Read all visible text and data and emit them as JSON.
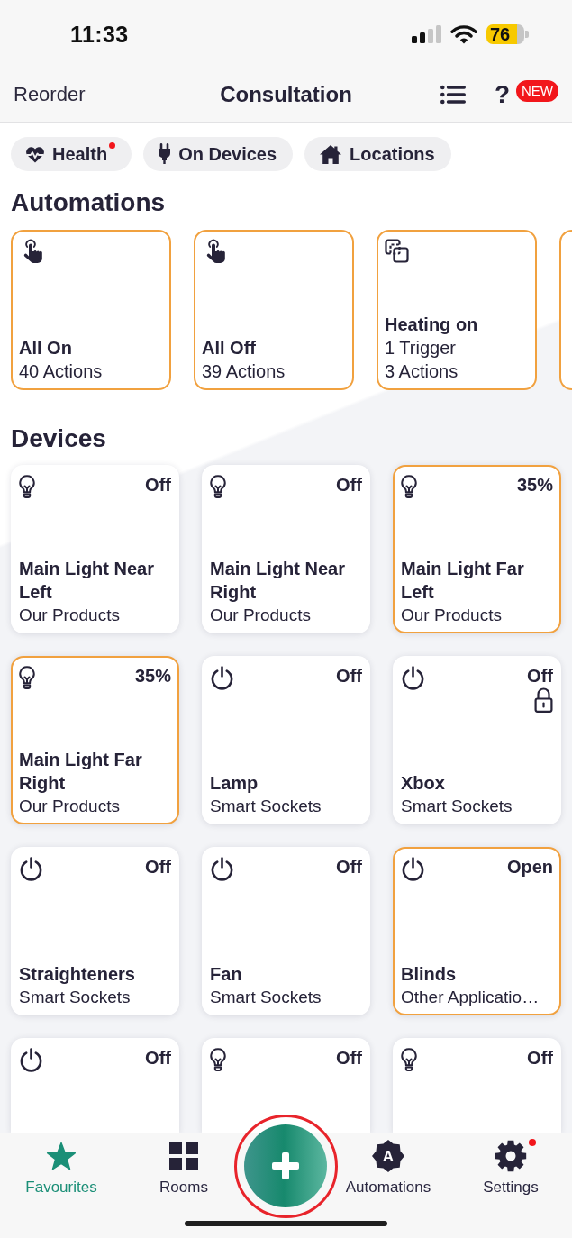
{
  "status_bar": {
    "time": "11:33",
    "battery": "76"
  },
  "nav_bar": {
    "reorder": "Reorder",
    "title": "Consultation",
    "help": "?",
    "help_badge": "NEW"
  },
  "filters": [
    {
      "kind": "health",
      "label": "Health",
      "notification": true
    },
    {
      "kind": "devices",
      "label": "On Devices",
      "notification": false
    },
    {
      "kind": "locations",
      "label": "Locations",
      "notification": false
    }
  ],
  "automations": {
    "heading": "Automations",
    "cards": [
      {
        "kind": "manual",
        "title": "All On",
        "details": [
          "40 Actions"
        ]
      },
      {
        "kind": "manual",
        "title": "All Off",
        "details": [
          "39 Actions"
        ]
      },
      {
        "kind": "triggered",
        "title": "Heating on",
        "details": [
          "1 Trigger",
          "3 Actions"
        ]
      }
    ]
  },
  "devices": {
    "heading": "Devices",
    "cards": [
      {
        "kind": "light",
        "status": "Off",
        "active": false,
        "locked": false,
        "name": "Main Light Near Left",
        "group": "Our Products"
      },
      {
        "kind": "light",
        "status": "Off",
        "active": false,
        "locked": false,
        "name": "Main Light Near Right",
        "group": "Our Products"
      },
      {
        "kind": "light",
        "status": "35%",
        "active": true,
        "locked": false,
        "name": "Main Light Far Left",
        "group": "Our Products"
      },
      {
        "kind": "light",
        "status": "35%",
        "active": true,
        "locked": false,
        "name": "Main Light Far Right",
        "group": "Our Products"
      },
      {
        "kind": "socket",
        "status": "Off",
        "active": false,
        "locked": false,
        "name": "Lamp",
        "group": "Smart Sockets"
      },
      {
        "kind": "socket",
        "status": "Off",
        "active": false,
        "locked": true,
        "name": "Xbox",
        "group": "Smart Sockets"
      },
      {
        "kind": "socket",
        "status": "Off",
        "active": false,
        "locked": false,
        "name": "Straighteners",
        "group": "Smart Sockets"
      },
      {
        "kind": "socket",
        "status": "Off",
        "active": false,
        "locked": false,
        "name": "Fan",
        "group": "Smart Sockets"
      },
      {
        "kind": "socket",
        "status": "Open",
        "active": true,
        "locked": false,
        "name": "Blinds",
        "group": "Other Applicatio…"
      },
      {
        "kind": "socket",
        "status": "Off",
        "active": false,
        "locked": false
      },
      {
        "kind": "light",
        "status": "Off",
        "active": false,
        "locked": false
      },
      {
        "kind": "light",
        "status": "Off",
        "active": false,
        "locked": false
      }
    ]
  },
  "tab_bar": {
    "tabs": [
      {
        "kind": "favourites",
        "label": "Favourites",
        "selected": true,
        "notification": false
      },
      {
        "kind": "rooms",
        "label": "Rooms",
        "selected": false,
        "notification": false
      },
      {
        "kind": "automations",
        "label": "Automations",
        "icon_letter": "A",
        "selected": false,
        "notification": false
      },
      {
        "kind": "settings",
        "label": "Settings",
        "selected": false,
        "notification": true
      }
    ],
    "add_button": {
      "highlighted": true
    }
  }
}
